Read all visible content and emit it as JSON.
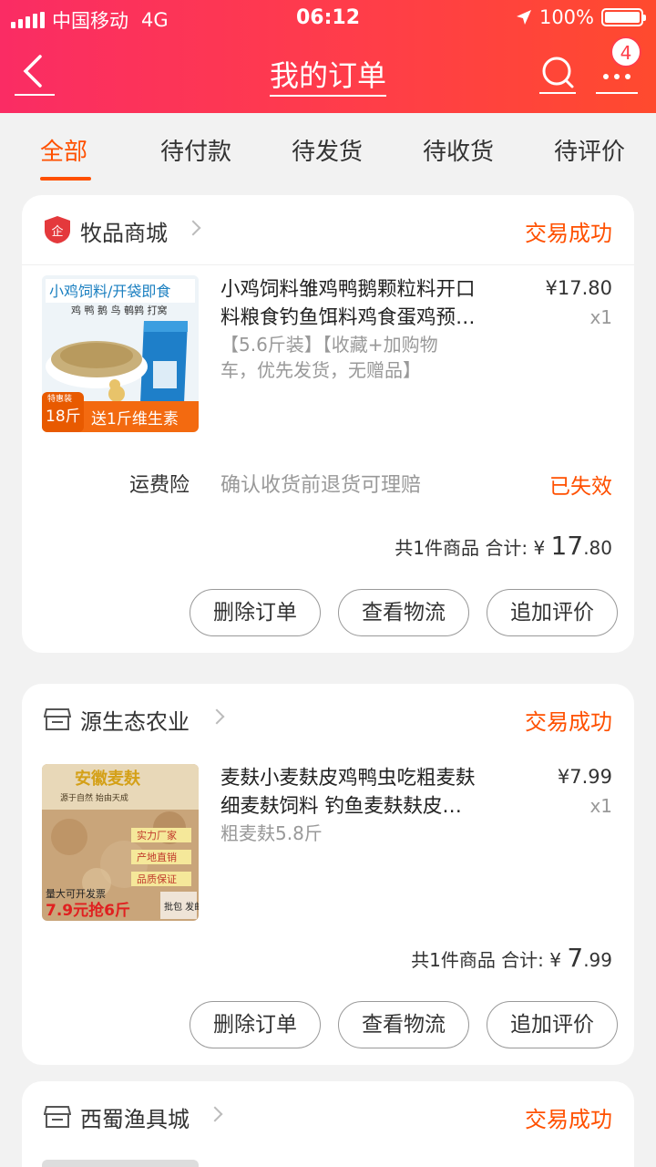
{
  "status_bar": {
    "carrier": "中国移动",
    "network": "4G",
    "time": "06:12",
    "battery": "100%"
  },
  "header": {
    "title": "我的订单",
    "badge_count": "4"
  },
  "tabs": [
    {
      "label": "全部",
      "active": true
    },
    {
      "label": "待付款"
    },
    {
      "label": "待发货"
    },
    {
      "label": "待收货"
    },
    {
      "label": "待评价"
    }
  ],
  "orders": [
    {
      "shop": "牧品商城",
      "status": "交易成功",
      "item": {
        "title_line1": "小鸡饲料雏鸡鸭鹅颗粒料开口",
        "title_line2": "料粮食钓鱼饵料鸡食蛋鸡预…",
        "sku_line1": "【5.6斤装】【收藏+加购物",
        "sku_line2": "车，优先发货，无赠品】",
        "price": "¥17.80",
        "qty": "x1",
        "thumb_headline": "小鸡饲料/开袋即食",
        "thumb_sub": "鸡 鸭 鹅 鸟 鹌鹑 打窝",
        "thumb_tag": "特惠装",
        "thumb_weight": "18斤",
        "thumb_promo": "送1斤维生素"
      },
      "insurance": {
        "label": "运费险",
        "desc": "确认收货前退货可理赔",
        "status": "已失效"
      },
      "summary": {
        "prefix": "共1件商品 合计: ¥ ",
        "amount_big": "17",
        "amount_small": ".80"
      },
      "buttons": [
        "删除订单",
        "查看物流",
        "追加评价"
      ]
    },
    {
      "shop": "源生态农业",
      "status": "交易成功",
      "item": {
        "title_line1": "麦麸小麦麸皮鸡鸭虫吃粗麦麸",
        "title_line2": "细麦麸饲料 钓鱼麦麸麸皮…",
        "sku_line1": "粗麦麸5.8斤",
        "price": "¥7.99",
        "qty": "x1",
        "thumb_headline": "安徽麦麸",
        "thumb_sub": "源于自然  始由天成",
        "thumb_badges": [
          "实力厂家",
          "产地直销",
          "品质保证"
        ],
        "thumb_invoice": "量大可开发票",
        "thumb_promo": "7.9元抢6斤",
        "thumb_ship": "批包 发邮"
      },
      "summary": {
        "prefix": "共1件商品 合计: ¥ ",
        "amount_big": "7",
        "amount_small": ".99"
      },
      "buttons": [
        "删除订单",
        "查看物流",
        "追加评价"
      ]
    },
    {
      "shop": "西蜀渔具城",
      "status": "交易成功"
    }
  ],
  "colors": {
    "accent": "#ff5000",
    "header_start": "#fa2c64",
    "header_end": "#ff4a2e"
  }
}
